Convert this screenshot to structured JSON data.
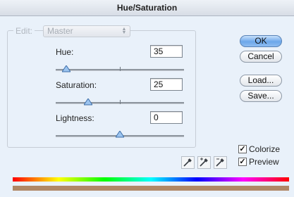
{
  "window": {
    "title": "Hue/Saturation"
  },
  "edit": {
    "label": "Edit:",
    "value": "Master"
  },
  "hue": {
    "label": "Hue:",
    "value": "35",
    "slider_fraction": 0.08
  },
  "saturation": {
    "label": "Saturation:",
    "value": "25",
    "slider_fraction": 0.25
  },
  "lightness": {
    "label": "Lightness:",
    "value": "0",
    "slider_fraction": 0.5
  },
  "buttons": {
    "ok": "OK",
    "cancel": "Cancel",
    "load": "Load...",
    "save": "Save..."
  },
  "options": {
    "colorize": {
      "label": "Colorize",
      "checked": true
    },
    "preview": {
      "label": "Preview",
      "checked": true
    }
  },
  "colors": {
    "accent": "#6ca7ea",
    "result_bar": "#b08866"
  },
  "icons": {
    "eyedropper": "eyedropper-icon",
    "eyedropper_plus": "eyedropper-plus-icon",
    "eyedropper_minus": "eyedropper-minus-icon"
  }
}
